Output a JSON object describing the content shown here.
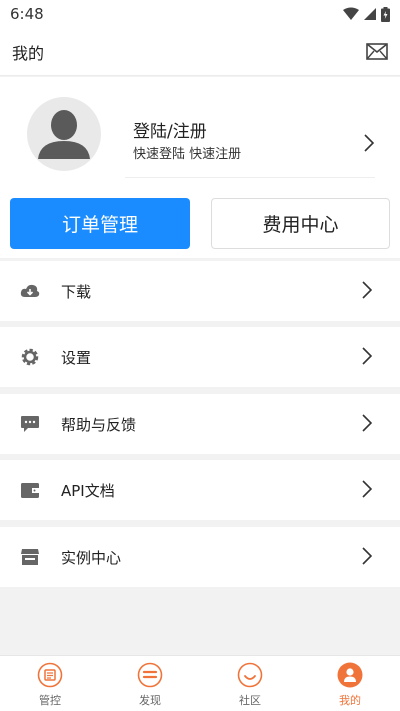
{
  "status": {
    "time": "6:48"
  },
  "header": {
    "title": "我的"
  },
  "profile": {
    "name": "登陆/注册",
    "subtitle": "快速登陆 快速注册"
  },
  "actions": {
    "primary": "订单管理",
    "secondary": "费用中心"
  },
  "menu": [
    {
      "label": "下载",
      "icon": "cloud-download-icon"
    },
    {
      "label": "设置",
      "icon": "gear-icon"
    },
    {
      "label": "帮助与反馈",
      "icon": "chat-icon"
    },
    {
      "label": "API文档",
      "icon": "wallet-icon"
    },
    {
      "label": "实例中心",
      "icon": "store-icon"
    }
  ],
  "tabs": [
    {
      "label": "管控",
      "icon": "manage-icon",
      "active": false
    },
    {
      "label": "发现",
      "icon": "discover-icon",
      "active": false
    },
    {
      "label": "社区",
      "icon": "community-icon",
      "active": false
    },
    {
      "label": "我的",
      "icon": "profile-icon",
      "active": true
    }
  ],
  "colors": {
    "accent": "#1a8cff",
    "tab_active": "#f0743a",
    "tab_inactive": "#f0743a",
    "icon_gray": "#666666"
  }
}
